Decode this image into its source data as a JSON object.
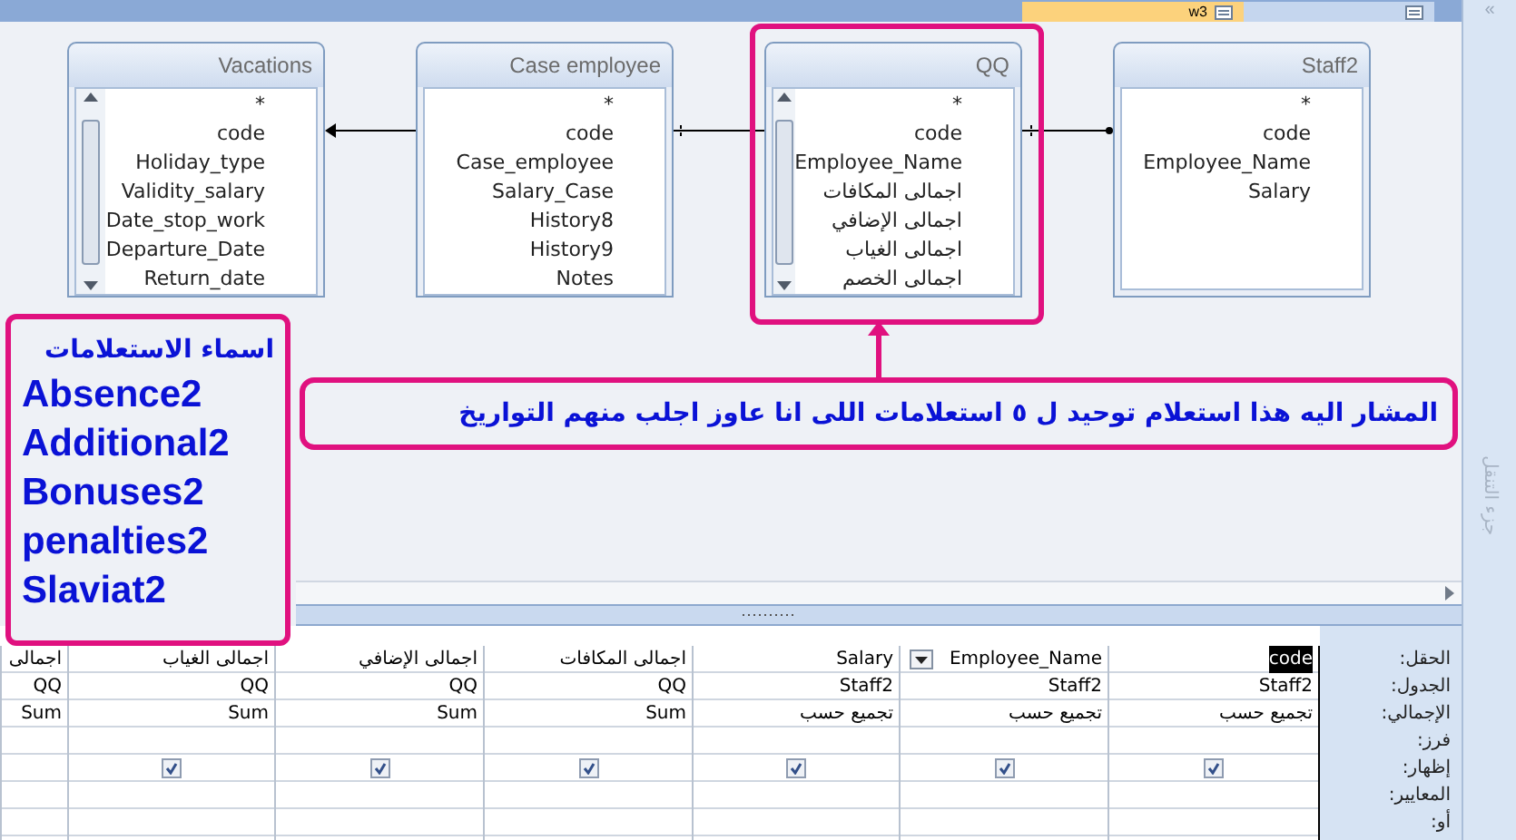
{
  "document_tabs": [
    {
      "label": "w3",
      "selected": true
    },
    {
      "selected": false
    }
  ],
  "tables": [
    {
      "title": "Staff2",
      "scrollbar": false,
      "fields": [
        "*",
        "code",
        "Employee_Name",
        "Salary"
      ]
    },
    {
      "title": "QQ",
      "scrollbar": true,
      "fields": [
        "*",
        "code",
        "Employee_Name",
        "اجمالى المكافات",
        "اجمالى الإضافي",
        "اجمالى الغياب",
        "اجمالى الخصم"
      ]
    },
    {
      "title": "Case employee",
      "scrollbar": false,
      "fields": [
        "*",
        "code",
        "Case_employee",
        "Salary_Case",
        "History8",
        "History9",
        "Notes"
      ]
    },
    {
      "title": "Vacations",
      "scrollbar": true,
      "fields": [
        "*",
        "code",
        "Holiday_type",
        "Validity_salary",
        "Date_stop_work",
        "Departure_Date",
        "Return_date"
      ]
    }
  ],
  "annotation_list": {
    "title": "اسماء الاستعلامات",
    "items": [
      "Absence2",
      "Additional2",
      "Bonuses2",
      "penalties2",
      "Slaviat2"
    ]
  },
  "annotation_note": "المشار اليه هذا استعلام توحيد ل ٥ استعلامات اللى انا عاوز اجلب منهم التواريخ",
  "navigation_pane": {
    "toggle": "«",
    "label": "جزء التنقل"
  },
  "grid": {
    "row_labels": [
      "الحقل:",
      "الجدول:",
      "الإجمالي:",
      "فرز:",
      "إظهار:",
      "المعايير:",
      "أو:"
    ],
    "columns": [
      {
        "field": "code",
        "table": "Staff2",
        "total": "تجميع حسب",
        "show": true,
        "selected": true,
        "dropdown": false
      },
      {
        "field": "Employee_Name",
        "table": "Staff2",
        "total": "تجميع حسب",
        "show": true,
        "selected": false,
        "dropdown": true
      },
      {
        "field": "Salary",
        "table": "Staff2",
        "total": "تجميع حسب",
        "show": true,
        "selected": false,
        "dropdown": false
      },
      {
        "field": "اجمالى المكافات",
        "table": "QQ",
        "total": "Sum",
        "show": true,
        "selected": false,
        "dropdown": false
      },
      {
        "field": "اجمالى الإضافي",
        "table": "QQ",
        "total": "Sum",
        "show": true,
        "selected": false,
        "dropdown": false
      },
      {
        "field": "اجمالى الغياب",
        "table": "QQ",
        "total": "Sum",
        "show": true,
        "selected": false,
        "dropdown": false
      },
      {
        "field": "اجمالى",
        "table": "QQ",
        "total": "Sum",
        "selected": false,
        "dropdown": false
      }
    ]
  }
}
